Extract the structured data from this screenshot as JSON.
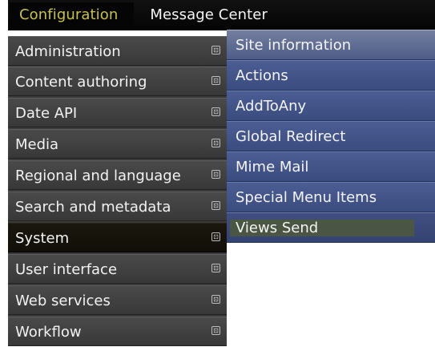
{
  "toolbar": {
    "active_tab": "Configuration",
    "second_tab": "Message Center"
  },
  "menu": {
    "items": [
      {
        "label": "Administration",
        "arrow": "⊡"
      },
      {
        "label": "Content authoring",
        "arrow": "⊡"
      },
      {
        "label": "Date API",
        "arrow": "⊡"
      },
      {
        "label": "Media",
        "arrow": "⊡"
      },
      {
        "label": "Regional and language",
        "arrow": "⊡"
      },
      {
        "label": "Search and metadata",
        "arrow": "⊡"
      },
      {
        "label": "System",
        "arrow": "⊡"
      },
      {
        "label": "User interface",
        "arrow": "⊡"
      },
      {
        "label": "Web services",
        "arrow": "⊡"
      },
      {
        "label": "Workflow",
        "arrow": "⊡"
      }
    ]
  },
  "submenu": {
    "items": [
      {
        "label": "Site information"
      },
      {
        "label": "Actions"
      },
      {
        "label": "AddToAny"
      },
      {
        "label": "Global Redirect"
      },
      {
        "label": "Mime Mail"
      },
      {
        "label": "Special Menu Items"
      },
      {
        "label": "Views Send"
      }
    ]
  },
  "colors": {
    "toolbar_background": "#0b0b0b",
    "active_tab_text": "#c8c04f",
    "menu_background": "#3a3a3a",
    "selected_item_background": "#120f08",
    "submenu_background": "#3d4f82",
    "submenu_highlight": "#4b5740"
  }
}
